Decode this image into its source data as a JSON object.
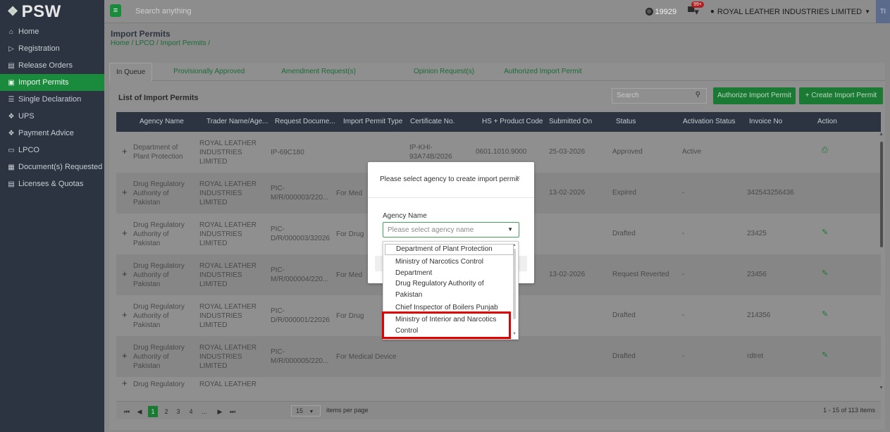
{
  "brand": {
    "logo_text": "PSW",
    "logo_icon": "psw-diamond-icon"
  },
  "sidebar": {
    "items": [
      {
        "label": "Home",
        "icon": "home-icon",
        "active": false
      },
      {
        "label": "Registration",
        "icon": "registration-icon",
        "active": false
      },
      {
        "label": "Release Orders",
        "icon": "release-orders-icon",
        "active": false
      },
      {
        "label": "Import Permits",
        "icon": "import-permits-icon",
        "active": true
      },
      {
        "label": "Single Declaration",
        "icon": "single-declaration-icon",
        "active": false
      },
      {
        "label": "UPS",
        "icon": "ups-icon",
        "active": false
      },
      {
        "label": "Payment Advice",
        "icon": "payment-advice-icon",
        "active": false
      },
      {
        "label": "LPCO",
        "icon": "lpco-icon",
        "active": false
      },
      {
        "label": "Document(s) Requested",
        "icon": "documents-requested-icon",
        "active": false
      },
      {
        "label": "Licenses & Quotas",
        "icon": "licenses-quotas-icon",
        "active": false
      }
    ]
  },
  "topbar": {
    "search_placeholder": "Search anything",
    "balance": "19929",
    "notification_badge": "99+",
    "company_name": "ROYAL LEATHER INDUSTRIES LIMITED",
    "avatar_text": "TI"
  },
  "page": {
    "title": "Import Permits",
    "breadcrumb": "Home / LPCO / Import Permits /"
  },
  "tabs": [
    {
      "label": "In Queue",
      "active": true
    },
    {
      "label": "Provisionally Approved",
      "active": false
    },
    {
      "label": "Amendment Request(s)",
      "active": false
    },
    {
      "label": "Opinion Request(s)",
      "active": false
    },
    {
      "label": "Authorized Import Permit",
      "active": false
    }
  ],
  "list": {
    "title": "List of Import Permits",
    "search_placeholder": "Search",
    "authorize_button": "Authorize Import Permit",
    "create_button": "+ Create Import Permit"
  },
  "table": {
    "headers": [
      "Agency Name",
      "Trader Name/Age...",
      "Request Docume...",
      "Import Permit Type",
      "Certificate No.",
      "HS + Product Code",
      "Submitted On",
      "Status",
      "Activation Status",
      "Invoice No",
      "Action"
    ],
    "rows": [
      {
        "agency": [
          "Department of",
          "Plant Protection"
        ],
        "trader": [
          "ROYAL LEATHER",
          "INDUSTRIES",
          "LIMITED"
        ],
        "request": [
          "IP-69C180"
        ],
        "type": [
          ""
        ],
        "certificate": [
          "IP-KHI-",
          "93A74B/2026"
        ],
        "hs": "0601.1010.9000",
        "submitted": "25-03-2026",
        "status": "Approved",
        "activation": "Active",
        "invoice": "",
        "action_icon": "print-icon"
      },
      {
        "agency": [
          "Drug Regulatory",
          "Authority of",
          "Pakistan"
        ],
        "trader": [
          "ROYAL LEATHER",
          "INDUSTRIES",
          "LIMITED"
        ],
        "request": [
          "PIC-",
          "M/R/000003/220..."
        ],
        "type": [
          "For Med"
        ],
        "certificate": [
          ""
        ],
        "hs": "",
        "submitted": "13-02-2026",
        "status": "Expired",
        "activation": "-",
        "invoice": "342543256436",
        "action_icon": ""
      },
      {
        "agency": [
          "Drug Regulatory",
          "Authority of",
          "Pakistan"
        ],
        "trader": [
          "ROYAL LEATHER",
          "INDUSTRIES",
          "LIMITED"
        ],
        "request": [
          "PIC-",
          "D/R/000003/32026"
        ],
        "type": [
          "For Drug"
        ],
        "certificate": [
          ""
        ],
        "hs": "",
        "submitted": "",
        "status": "Drafted",
        "activation": "-",
        "invoice": "23425",
        "action_icon": "edit-icon"
      },
      {
        "agency": [
          "Drug Regulatory",
          "Authority of",
          "Pakistan"
        ],
        "trader": [
          "ROYAL LEATHER",
          "INDUSTRIES",
          "LIMITED"
        ],
        "request": [
          "PIC-",
          "M/R/000004/220..."
        ],
        "type": [
          "For Med"
        ],
        "certificate": [
          ""
        ],
        "hs": "",
        "submitted": "13-02-2026",
        "status": "Request Reverted",
        "activation": "-",
        "invoice": "23456",
        "action_icon": "edit-icon"
      },
      {
        "agency": [
          "Drug Regulatory",
          "Authority of",
          "Pakistan"
        ],
        "trader": [
          "ROYAL LEATHER",
          "INDUSTRIES",
          "LIMITED"
        ],
        "request": [
          "PIC-",
          "D/R/000001/22026"
        ],
        "type": [
          "For Drug"
        ],
        "certificate": [
          ""
        ],
        "hs": "",
        "submitted": "",
        "status": "Drafted",
        "activation": "-",
        "invoice": "214356",
        "action_icon": "edit-icon"
      },
      {
        "agency": [
          "Drug Regulatory",
          "Authority of",
          "Pakistan"
        ],
        "trader": [
          "ROYAL LEATHER",
          "INDUSTRIES",
          "LIMITED"
        ],
        "request": [
          "PIC-",
          "M/R/000005/220..."
        ],
        "type": [
          "For Medical Device"
        ],
        "certificate": [
          ""
        ],
        "hs": "",
        "submitted": "",
        "status": "Drafted",
        "activation": "-",
        "invoice": "rdtret",
        "action_icon": "edit-icon"
      },
      {
        "agency": [
          "Drug Regulatory"
        ],
        "trader": [
          "ROYAL LEATHER"
        ],
        "request": [
          ""
        ],
        "type": [
          ""
        ],
        "certificate": [
          ""
        ],
        "hs": "",
        "submitted": "",
        "status": "",
        "activation": "",
        "invoice": "",
        "action_icon": ""
      }
    ]
  },
  "pagination": {
    "first": "⏮",
    "prev": "◀",
    "pages": [
      "1",
      "2",
      "3",
      "4",
      "..."
    ],
    "next": "▶",
    "last": "⏭",
    "current_page": "1",
    "per_page": "15",
    "per_page_label": "items per page",
    "info": "1 - 15 of 113 items"
  },
  "modal": {
    "title": "Please select agency to create import permit",
    "close": "×",
    "field_label": "Agency Name",
    "select_placeholder": "Please select agency name",
    "options": [
      [
        "Department of Plant Protection"
      ],
      [
        "Ministry of Narcotics Control",
        "Department"
      ],
      [
        "Drug Regulatory Authority of",
        "Pakistan"
      ],
      [
        "Chief Inspector of Boilers Punjab"
      ],
      [
        "Ministry of Interior and Narcotics",
        "Control"
      ]
    ],
    "highlighted_option_index": 4,
    "highlight_color": "#e30000"
  }
}
